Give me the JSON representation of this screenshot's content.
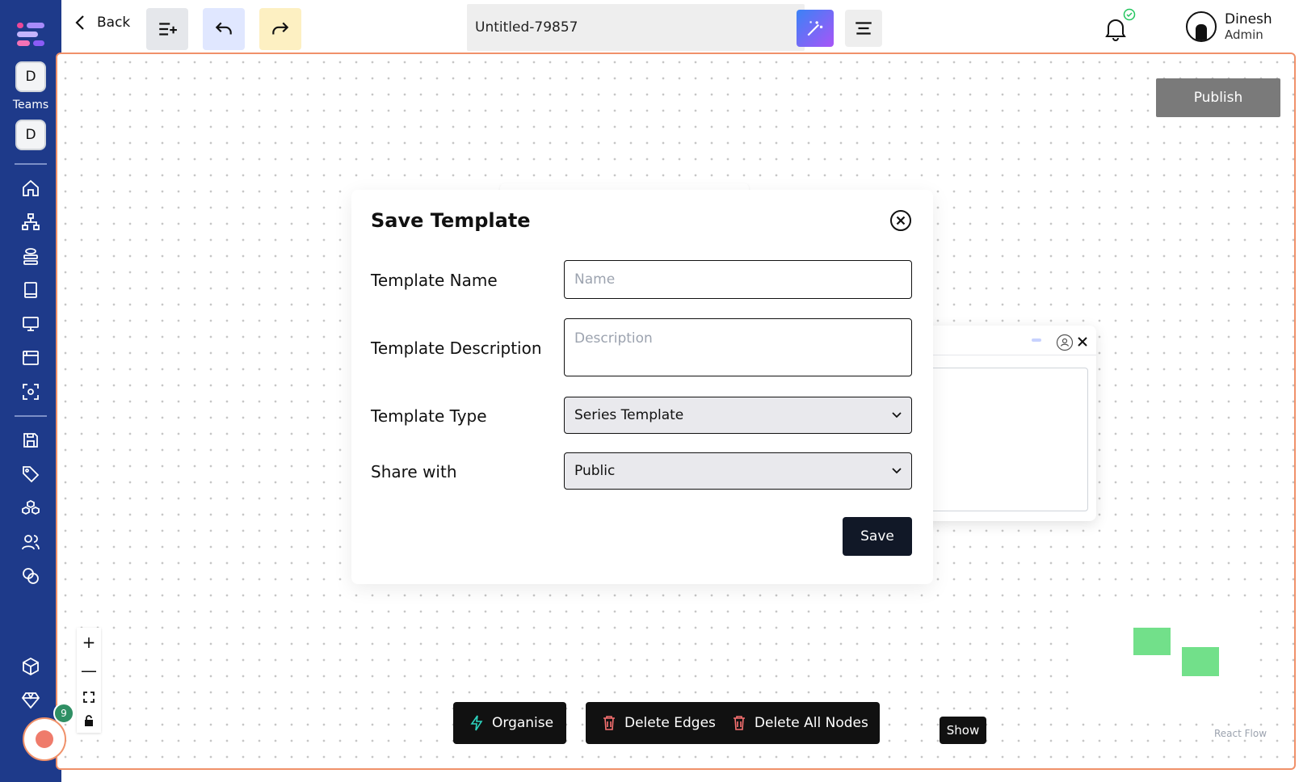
{
  "sidebar": {
    "team_badges": [
      "D",
      "D"
    ],
    "teams_label": "Teams",
    "nav_icons": [
      "home-icon",
      "sitemap-icon",
      "stack-icon",
      "book-icon",
      "monitor-icon",
      "browser-window-icon",
      "scan-icon"
    ],
    "tool_icons": [
      "save-icon",
      "tag-icon",
      "cubes-icon",
      "users-icon",
      "coins-icon"
    ],
    "footer_icons": [
      "package-icon",
      "diamond-icon"
    ]
  },
  "topbar": {
    "back_label": "Back",
    "document_title": "Untitled-79857",
    "user_name": "Dinesh",
    "user_role": "Admin"
  },
  "canvas": {
    "publish_label": "Publish",
    "show_label": "Show",
    "organise_label": "Organise",
    "delete_edges_label": "Delete Edges",
    "delete_all_nodes_label": "Delete All Nodes",
    "attribution": "React Flow",
    "zoom_in": "+",
    "zoom_out": "—",
    "notification_count": "9"
  },
  "modal": {
    "title": "Save Template",
    "name_label": "Template Name",
    "name_placeholder": "Name",
    "description_label": "Template Description",
    "description_placeholder": "Description",
    "type_label": "Template Type",
    "type_value": "Series Template",
    "share_label": "Share with",
    "share_value": "Public",
    "save_label": "Save"
  },
  "colors": {
    "sidebar": "#1e3a8a",
    "canvas_border": "#f0916a",
    "publish": "#7a7a7a",
    "magic_button": "#7c3aed",
    "minimap_node": "#72e08a"
  }
}
